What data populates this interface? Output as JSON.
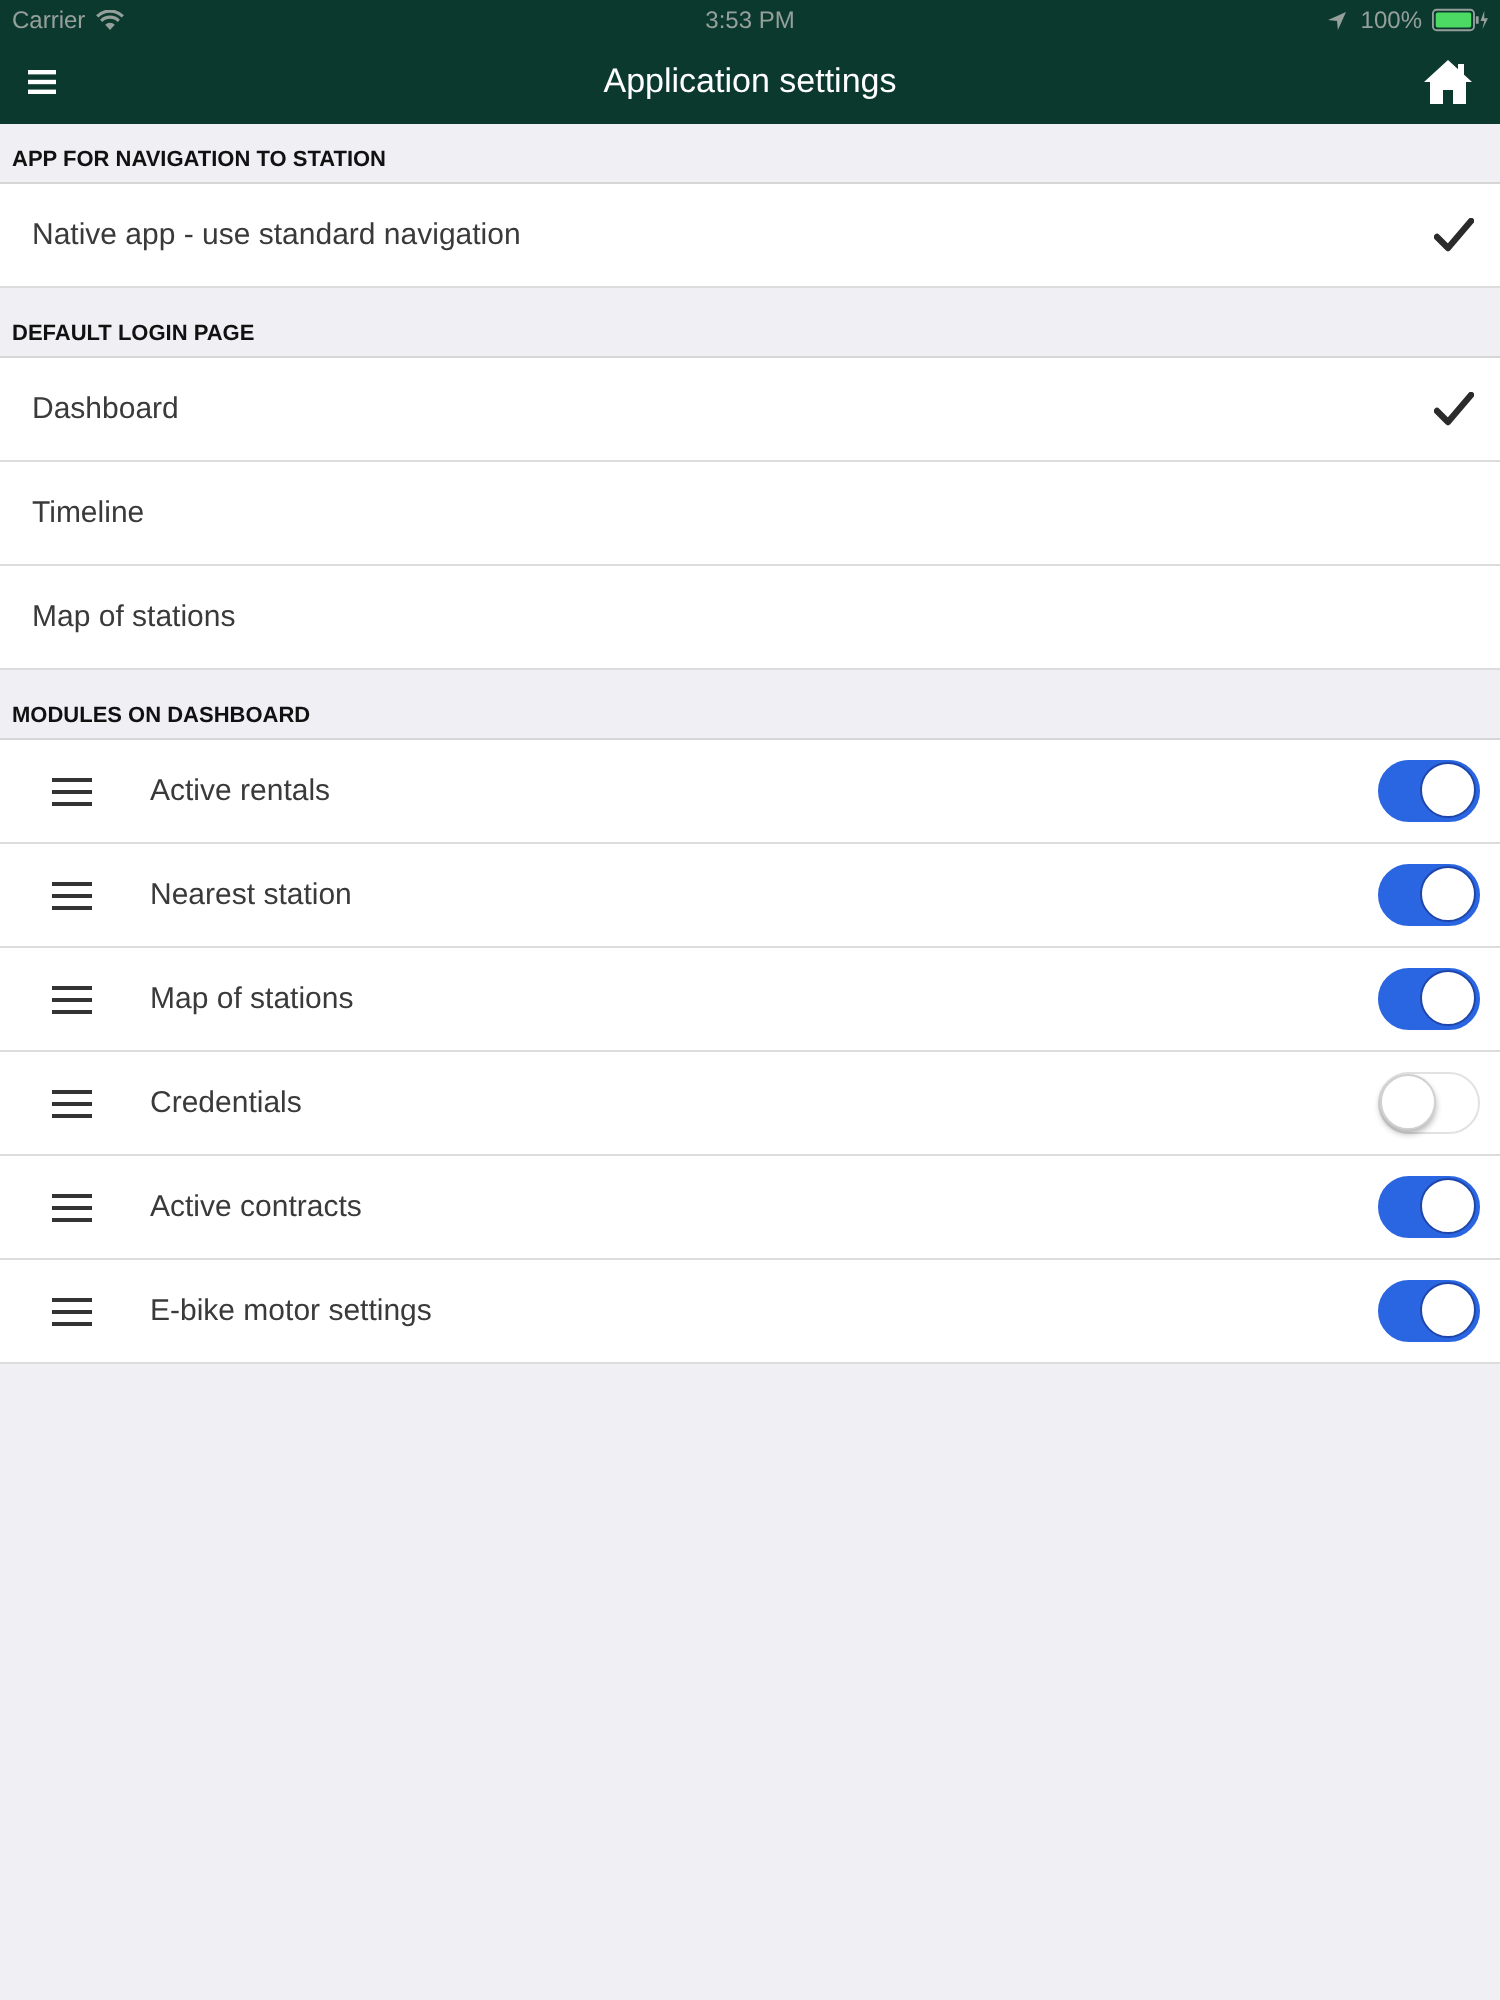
{
  "status_bar": {
    "carrier": "Carrier",
    "time": "3:53 PM",
    "battery": "100%"
  },
  "header": {
    "title": "Application settings"
  },
  "sections": [
    {
      "title": "APP FOR NAVIGATION TO STATION",
      "kind": "choice",
      "items": [
        {
          "label": "Native app - use standard navigation",
          "selected": true
        }
      ]
    },
    {
      "title": "DEFAULT LOGIN PAGE",
      "kind": "choice",
      "items": [
        {
          "label": "Dashboard",
          "selected": true
        },
        {
          "label": "Timeline",
          "selected": false
        },
        {
          "label": "Map of stations",
          "selected": false
        }
      ]
    },
    {
      "title": "MODULES ON DASHBOARD",
      "kind": "toggle",
      "items": [
        {
          "label": "Active rentals",
          "on": true
        },
        {
          "label": "Nearest station",
          "on": true
        },
        {
          "label": "Map of stations",
          "on": true
        },
        {
          "label": "Credentials",
          "on": false
        },
        {
          "label": "Active contracts",
          "on": true
        },
        {
          "label": "E-bike motor settings",
          "on": true
        }
      ]
    }
  ]
}
